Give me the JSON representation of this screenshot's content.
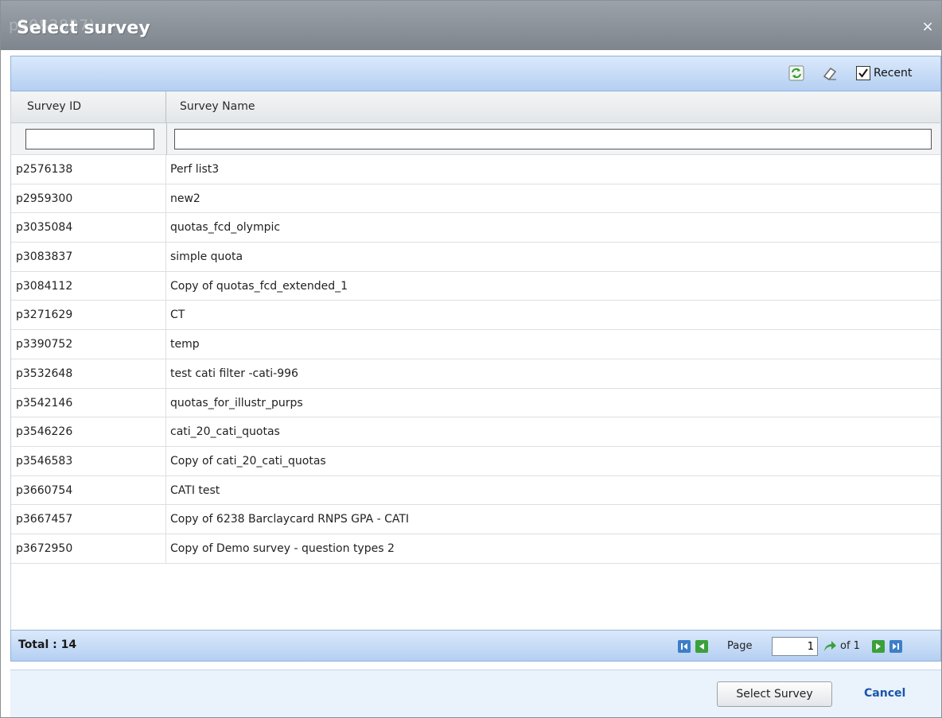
{
  "dialog": {
    "title": "Select survey",
    "title_ghost": "p3083837)",
    "close_glyph": "×"
  },
  "toolbar": {
    "refresh_icon": "refresh-icon",
    "clear_icon": "eraser-icon",
    "recent_label": "Recent",
    "recent_checked": true
  },
  "grid": {
    "columns": [
      "Survey ID",
      "Survey Name"
    ],
    "filters": [
      "",
      ""
    ],
    "rows": [
      {
        "id": "p2576138",
        "name": "Perf list3"
      },
      {
        "id": "p2959300",
        "name": "new2"
      },
      {
        "id": "p3035084",
        "name": "quotas_fcd_olympic"
      },
      {
        "id": "p3083837",
        "name": "simple quota"
      },
      {
        "id": "p3084112",
        "name": "Copy of quotas_fcd_extended_1"
      },
      {
        "id": "p3271629",
        "name": "CT"
      },
      {
        "id": "p3390752",
        "name": "temp"
      },
      {
        "id": "p3532648",
        "name": "test cati filter -cati-996"
      },
      {
        "id": "p3542146",
        "name": "quotas_for_illustr_purps"
      },
      {
        "id": "p3546226",
        "name": "cati_20_cati_quotas"
      },
      {
        "id": "p3546583",
        "name": "Copy of cati_20_cati_quotas"
      },
      {
        "id": "p3660754",
        "name": "CATI test"
      },
      {
        "id": "p3667457",
        "name": "Copy of 6238 Barclaycard RNPS GPA - CATI"
      },
      {
        "id": "p3672950",
        "name": "Copy of Demo survey - question types 2"
      }
    ]
  },
  "pager": {
    "total_label": "Total : 14",
    "page_label": "Page",
    "page_value": "1",
    "of_label": "of 1"
  },
  "footer": {
    "select_label": "Select Survey",
    "cancel_label": "Cancel"
  },
  "colors": {
    "accent": "#1a55a6",
    "toolbar_top": "#dbe9fb",
    "toolbar_bottom": "#b4cff2",
    "titlebar": "#8e959d"
  }
}
